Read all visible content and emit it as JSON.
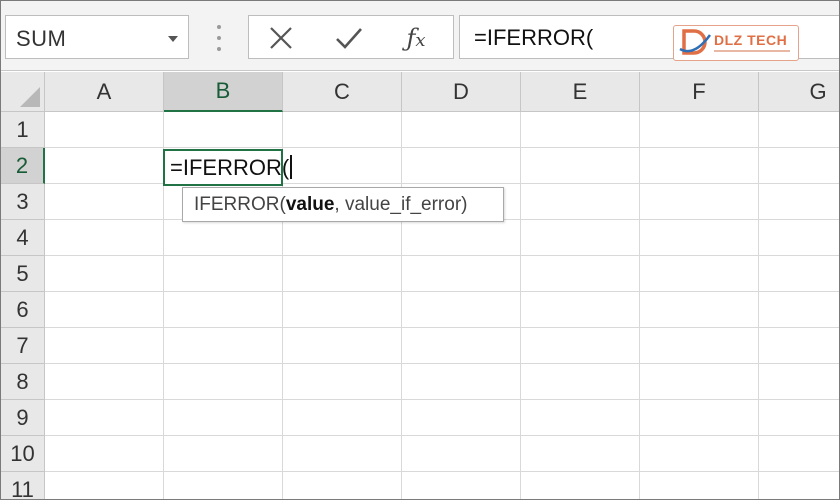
{
  "name_box": {
    "value": "SUM"
  },
  "formula_bar": {
    "cancel_icon": "close-icon",
    "enter_icon": "checkmark-icon",
    "fx_label": "fx",
    "value": "=IFERROR("
  },
  "watermark": {
    "text": "DLZ TECH",
    "accent_color": "#e06f45"
  },
  "columns": [
    "A",
    "B",
    "C",
    "D",
    "E",
    "F",
    "G"
  ],
  "rows": [
    "1",
    "2",
    "3",
    "4",
    "5",
    "6",
    "7",
    "8",
    "9",
    "10",
    "11"
  ],
  "selection": {
    "column": "B",
    "row": "2"
  },
  "active_cell": {
    "value": "=IFERROR("
  },
  "tooltip": {
    "function": "IFERROR(",
    "current_arg": "value",
    "rest": ", value_if_error)"
  },
  "colors": {
    "selection_green": "#217346",
    "header_bg": "#e8e8e8",
    "gridline": "#d9d9d9"
  }
}
